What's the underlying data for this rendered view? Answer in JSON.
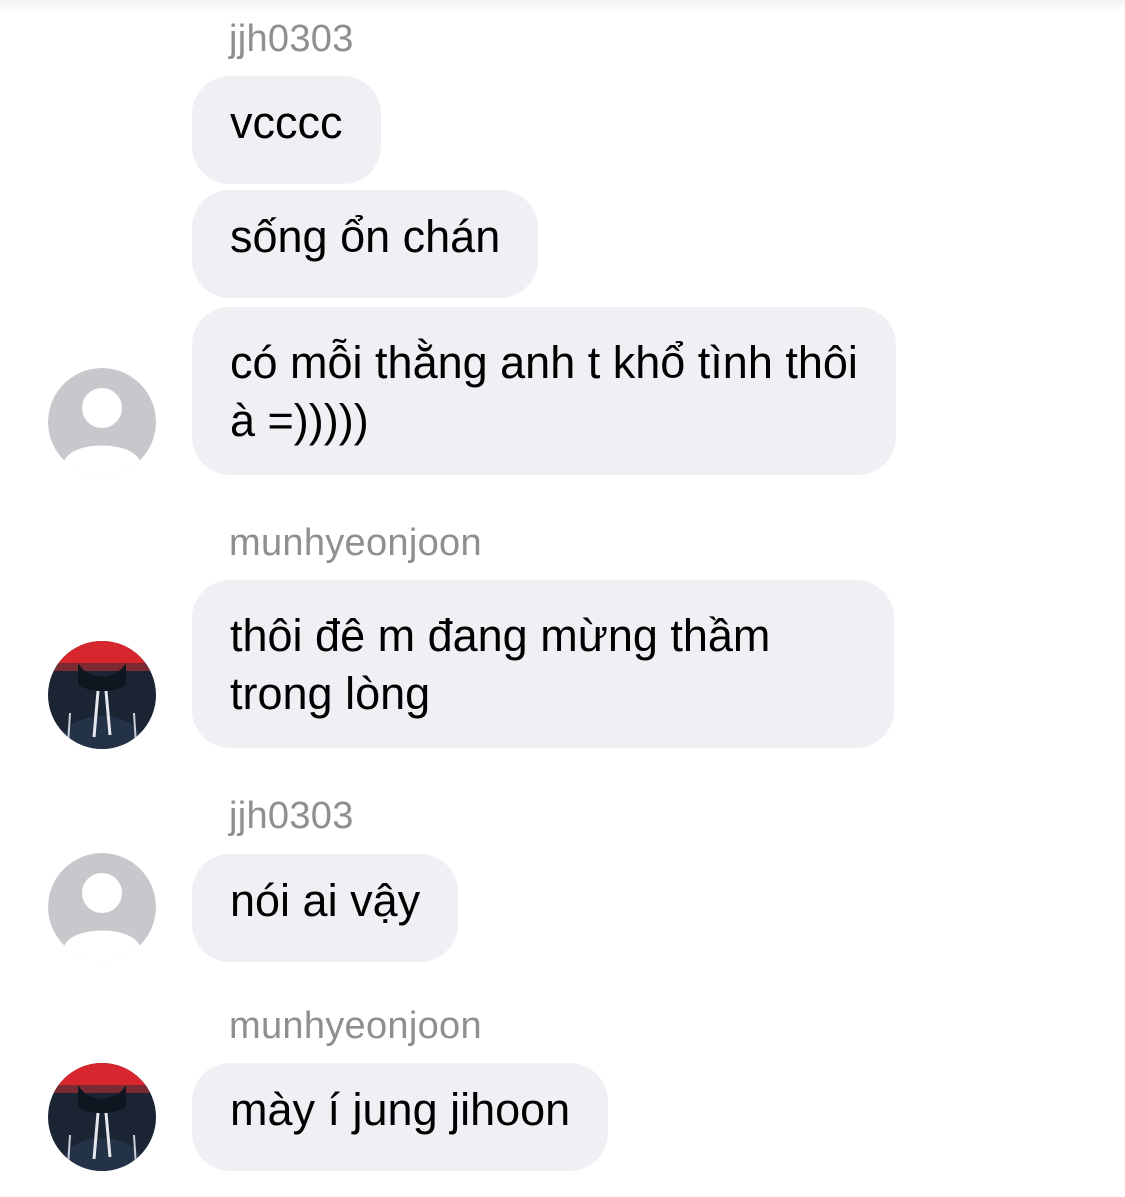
{
  "chat": {
    "messages": [
      {
        "sender": "jjh0303",
        "text": "vcccc"
      },
      {
        "text": "sống ổn chán"
      },
      {
        "text": "có mỗi thằng anh t khổ tình thôi à =)))))"
      },
      {
        "sender": "munhyeonjoon",
        "text": "thôi đê m đang mừng thầm trong lòng"
      },
      {
        "sender": "jjh0303",
        "text": "nói ai vậy"
      },
      {
        "sender": "munhyeonjoon",
        "text": "mày í jung jihoon"
      }
    ]
  },
  "colors": {
    "bubble_bg": "#efeff4",
    "sender_text": "#8e8e93",
    "placeholder_avatar": "#c7c7cc"
  },
  "icons": {
    "default_avatar": "default-avatar-icon",
    "photo_avatar": "user-photo-avatar"
  }
}
